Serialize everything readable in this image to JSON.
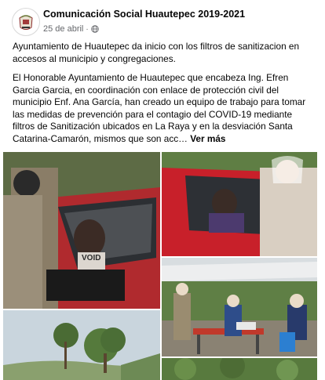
{
  "post": {
    "page_name": "Comunicación Social Huautepec 2019-2021",
    "date": "25 de abril",
    "separator": "·",
    "privacy_icon": "globe-icon",
    "paragraph1": "Ayuntamiento de Huautepec da inicio con los filtros de sanitizacion en accesos al municipio y congregaciones.",
    "paragraph2": "El Honorable Ayuntamiento de Huautepec que encabeza Ing. Efren Garcia Garcia, en coordinación con enlace de protección civil del municipio Enf. Ana García, han creado un equipo de trabajo para tomar las medidas de prevención para el contagio del COVID-19 mediante filtros de Sanitización ubicados en La Raya y en la desviación Santa Catarina-Camarón, mismos que son acc…",
    "see_more": "Ver más"
  },
  "photos": {
    "photo1_number": "VOID"
  },
  "colors": {
    "text": "#050505",
    "meta": "#65676b",
    "background": "#ffffff"
  }
}
